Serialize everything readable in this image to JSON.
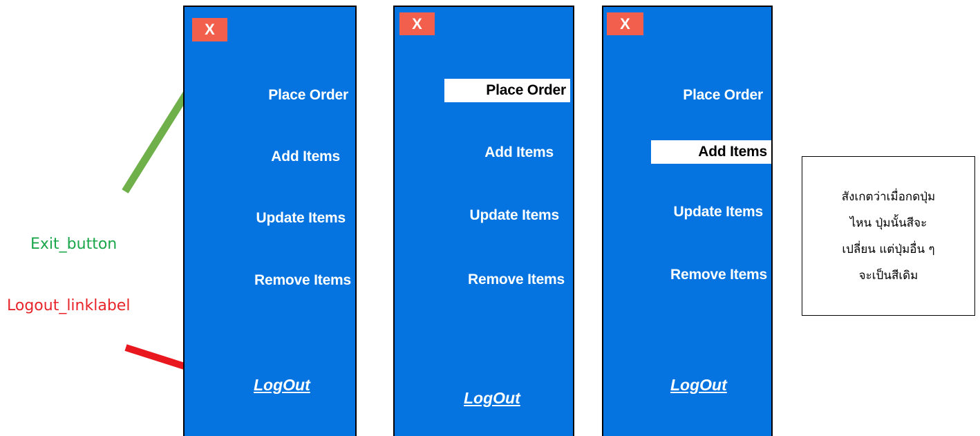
{
  "colors": {
    "panel_bg": "#0574e0",
    "exit_button_bg": "#f2604d",
    "selected_item_bg": "#ffffff",
    "annotation_exit": "#1aa64a",
    "annotation_logout": "#e8242b",
    "arrow_green": "#6fb04a",
    "arrow_red": "#e8181e"
  },
  "panels": [
    {
      "exit_label": "X",
      "items": [
        "Place Order",
        "Add Items",
        "Update Items",
        "Remove Items"
      ],
      "selected": null,
      "logout": "LogOut"
    },
    {
      "exit_label": "X",
      "items": [
        "Place Order",
        "Add Items",
        "Update Items",
        "Remove Items"
      ],
      "selected": "Place Order",
      "logout": "LogOut"
    },
    {
      "exit_label": "X",
      "items": [
        "Place Order",
        "Add Items",
        "Update Items",
        "Remove Items"
      ],
      "selected": "Add Items",
      "logout": "LogOut"
    }
  ],
  "annotations": {
    "exit_button": "Exit_button",
    "logout_linklabel": "Logout_linklabel"
  },
  "note": {
    "lines": [
      "สังเกตว่าเมื่อกดปุ่ม",
      "ไหน ปุ่มนั้นสีจะ",
      "เปลี่ยน แต่ปุ่มอื่น ๆ",
      "จะเป็นสีเดิม"
    ]
  }
}
